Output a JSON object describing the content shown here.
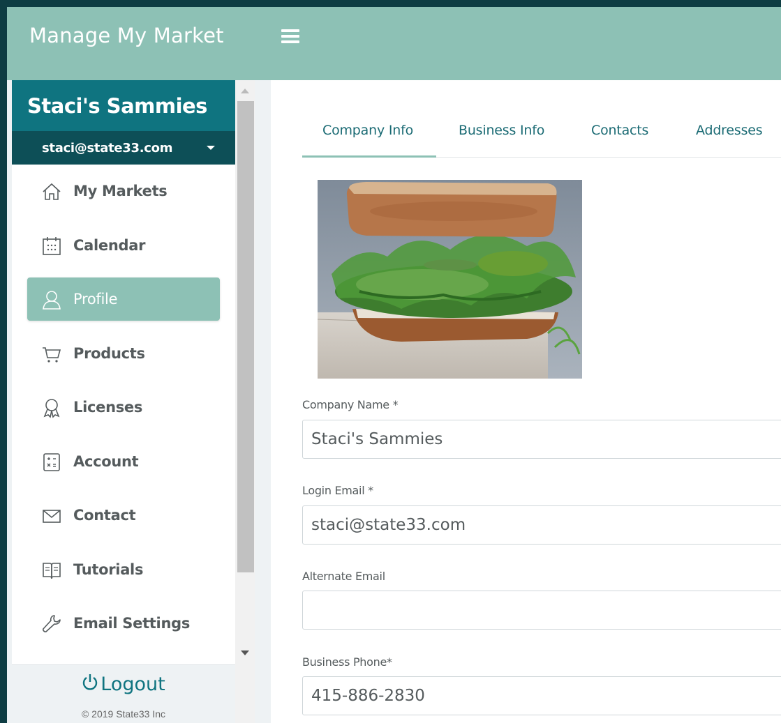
{
  "app": {
    "title": "Manage My Market"
  },
  "sidebar": {
    "company_name": "Staci's Sammies",
    "user_email": "staci@state33.com",
    "items": [
      {
        "label": "My Markets",
        "icon": "home-icon"
      },
      {
        "label": "Calendar",
        "icon": "calendar-icon"
      },
      {
        "label": "Profile",
        "icon": "user-icon",
        "active": true
      },
      {
        "label": "Products",
        "icon": "cart-icon"
      },
      {
        "label": "Licenses",
        "icon": "award-icon"
      },
      {
        "label": "Account",
        "icon": "calculator-icon"
      },
      {
        "label": "Contact",
        "icon": "envelope-icon"
      },
      {
        "label": "Tutorials",
        "icon": "book-icon"
      },
      {
        "label": "Email Settings",
        "icon": "wrench-icon"
      }
    ],
    "logout_label": "Logout",
    "copyright": "© 2019 State33 Inc"
  },
  "tabs": [
    {
      "label": "Company Info",
      "active": true
    },
    {
      "label": "Business Info"
    },
    {
      "label": "Contacts"
    },
    {
      "label": "Addresses"
    }
  ],
  "form": {
    "company_name": {
      "label": "Company Name *",
      "value": "Staci's Sammies"
    },
    "login_email": {
      "label": "Login Email *",
      "value": "staci@state33.com"
    },
    "alternate_email": {
      "label": "Alternate Email",
      "value": ""
    },
    "business_phone": {
      "label": "Business Phone*",
      "value": "415-886-2830"
    }
  },
  "colors": {
    "topbar": "#8dc1b5",
    "company_header": "#0f7480",
    "user_row": "#0d4f57",
    "active_nav": "#8dc1b5",
    "frame": "#0e3d43"
  }
}
